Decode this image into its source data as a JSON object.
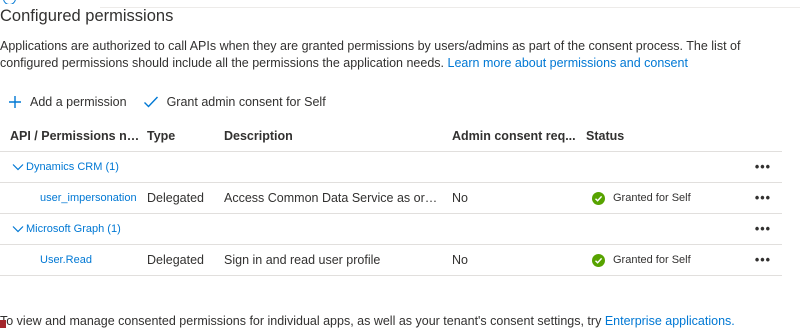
{
  "page": {
    "title": "Configured permissions",
    "description": "Applications are authorized to call APIs when they are granted permissions by users/admins as part of the consent process. The list of configured permissions should include all the permissions the application needs.",
    "learn_more_link": "Learn more about permissions and consent"
  },
  "toolbar": {
    "add_permission": "Add a permission",
    "grant_consent": "Grant admin consent for Self"
  },
  "table": {
    "headers": {
      "api": "API / Permissions na...",
      "type": "Type",
      "description": "Description",
      "admin": "Admin consent req...",
      "status": "Status"
    },
    "groups": [
      {
        "name": "Dynamics CRM (1)",
        "permissions": [
          {
            "name": "user_impersonation",
            "type": "Delegated",
            "description": "Access Common Data Service as orga...",
            "admin": "No",
            "status": "Granted for Self"
          }
        ]
      },
      {
        "name": "Microsoft Graph (1)",
        "permissions": [
          {
            "name": "User.Read",
            "type": "Delegated",
            "description": "Sign in and read user profile",
            "admin": "No",
            "status": "Granted for Self"
          }
        ]
      }
    ],
    "more_symbol": "•••"
  },
  "footer": {
    "text": "To view and manage consented permissions for individual apps, as well as your tenant's consent settings, try",
    "link": "Enterprise applications."
  },
  "colors": {
    "link": "#0078d4",
    "granted": "#57a300"
  }
}
